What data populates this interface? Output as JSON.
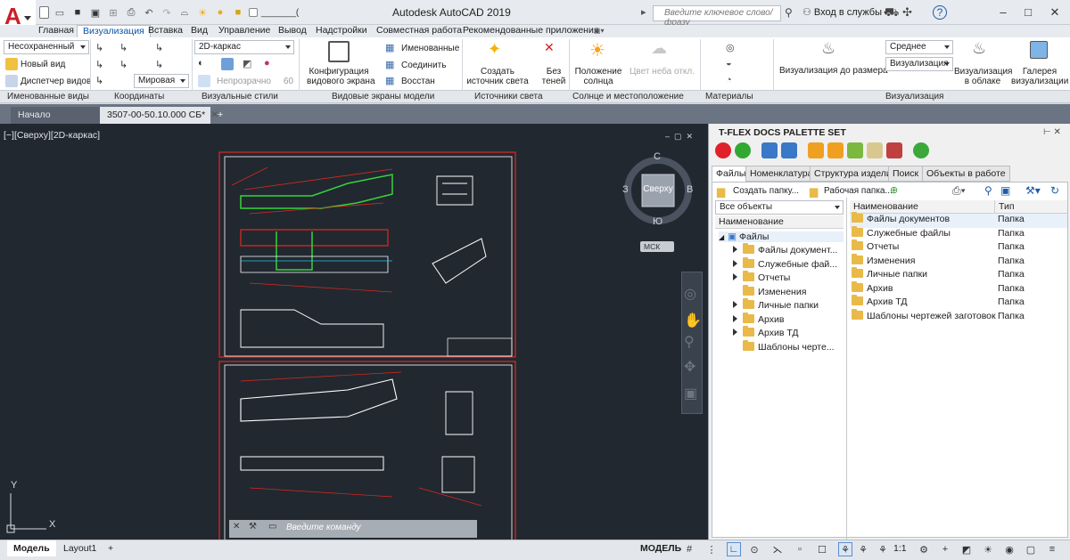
{
  "app": {
    "logo_letter": "A",
    "title": "Autodesk AutoCAD 2019"
  },
  "qat": {
    "icons": [
      "new-icon",
      "open-icon",
      "save-icon",
      "saveas-icon",
      "print-icon",
      "undo-icon",
      "redo-icon",
      "share-icon"
    ],
    "sun_icons": [
      "sun-icon",
      "bulb-icon",
      "lock-icon"
    ],
    "layer_text": "_______(  ",
    "paren": "("
  },
  "search": {
    "placeholder": "Введите ключевое слово/фразу"
  },
  "login": {
    "label": "Вход в службы"
  },
  "menu_tabs": [
    "Главная",
    "Визуализация",
    "Вставка",
    "Вид",
    "Управление",
    "Вывод",
    "Надстройки",
    "Совместная работа",
    "Рекомендованные приложения"
  ],
  "active_tab": "Визуализация",
  "ribbon": {
    "named_views": {
      "dropdown": "Несохраненный",
      "new_view": "Новый вид",
      "view_manager": "Диспетчер видов"
    },
    "coords": {
      "dropdown": "Мировая"
    },
    "visual_styles": {
      "dropdown": "2D-каркас",
      "opacity_label": "Непрозрачно",
      "opacity_value": "60"
    },
    "viewport_config": {
      "label1": "Конфигурация",
      "label2": "видового экрана"
    },
    "viewport_items": [
      "Именованные",
      "Соединить",
      "Восстан"
    ],
    "lights": {
      "create1": "Создать",
      "create2": "источник света",
      "noshadow1": "Без",
      "noshadow2": "теней"
    },
    "sun": {
      "pos1": "Положение",
      "pos2": "солнца",
      "sky": "Цвет неба откл."
    },
    "render": {
      "preset": "Среднее",
      "mode": "Визуализация",
      "render_size": "Визуализация до размера",
      "cloud1": "Визуализация",
      "cloud2": "в облаке",
      "gallery1": "Галерея",
      "gallery2": "визуализации"
    }
  },
  "panel_labels": [
    "Именованные виды",
    "Координаты",
    "Визуальные стили",
    "Видовые экраны модели",
    "Источники света",
    "Солнце и местоположение",
    "Материалы",
    "Визуализация"
  ],
  "doc_tabs": [
    {
      "label": "Начало",
      "active": false
    },
    {
      "label": "3507-00-50.10.000 СБ*",
      "active": true
    }
  ],
  "viewport": {
    "label": "[−][Сверху][2D-каркас]",
    "cube_top": "Сверху",
    "north": "С",
    "south": "Ю",
    "west": "З",
    "east": "В",
    "wcs": "МСК",
    "ucs_y": "Y",
    "ucs_x": "X",
    "cmd_placeholder": "Введите команду"
  },
  "layout_tabs": [
    "Модель",
    "Layout1"
  ],
  "status": {
    "model": "МОДЕЛЬ",
    "scale": "1:1"
  },
  "palette": {
    "title": "T-FLEX DOCS PALETTE SET",
    "tabs": [
      "Файлы",
      "Номенклатура",
      "Структура изделия",
      "Поиск",
      "Объекты в работе"
    ],
    "create_folder": "Создать папку...",
    "workspace": "Рабочая папка...",
    "filter": "Все объекты",
    "left_header": "Наименование",
    "root": "Файлы",
    "tree": [
      "Файлы документ...",
      "Служебные фай...",
      "Отчеты",
      "Изменения",
      "Личные папки",
      "Архив",
      "Архив ТД",
      "Шаблоны черте..."
    ],
    "tree_expandable": [
      true,
      true,
      true,
      false,
      true,
      true,
      true,
      false
    ],
    "col_name": "Наименование",
    "col_type": "Тип",
    "rows": [
      {
        "name": "Файлы документов",
        "type": "Папка"
      },
      {
        "name": "Служебные файлы",
        "type": "Папка"
      },
      {
        "name": "Отчеты",
        "type": "Папка"
      },
      {
        "name": "Изменения",
        "type": "Папка"
      },
      {
        "name": "Личные папки",
        "type": "Папка"
      },
      {
        "name": "Архив",
        "type": "Папка"
      },
      {
        "name": "Архив ТД",
        "type": "Папка"
      },
      {
        "name": "Шаблоны чертежей заготовок",
        "type": "Папка"
      }
    ]
  },
  "colors": {
    "accent": "#0a55a5",
    "canvas": "#212830",
    "drawing_red": "#e0281e",
    "drawing_green": "#39d23c"
  }
}
